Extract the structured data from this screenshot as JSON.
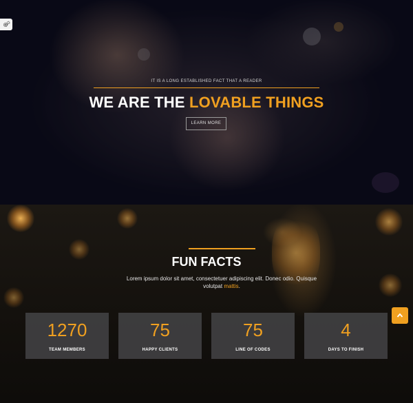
{
  "hero": {
    "subtitle": "IT IS A LONG ESTABLISHED FACT THAT A READER",
    "title_prefix": "WE ARE THE ",
    "title_accent": "LOVABLE THINGS",
    "button_label": "LEARN MORE"
  },
  "facts": {
    "title": "FUN FACTS",
    "text_main": "Lorem ipsum dolor sit amet, consectetuer adipiscing elit. Donec odio. Quisque volutpat ",
    "text_link": "mattis",
    "text_end": ".",
    "stats": [
      {
        "number": "1270",
        "label": "TEAM MEMBERS"
      },
      {
        "number": "75",
        "label": "HAPPY CLIENTS"
      },
      {
        "number": "75",
        "label": "LINE OF CODES"
      },
      {
        "number": "4",
        "label": "DAYS TO FINISH"
      }
    ]
  },
  "icons": {
    "settings": "gears-icon",
    "scroll_top": "chevron-up-icon"
  },
  "colors": {
    "accent": "#f0a020",
    "stat_box": "#464648"
  }
}
